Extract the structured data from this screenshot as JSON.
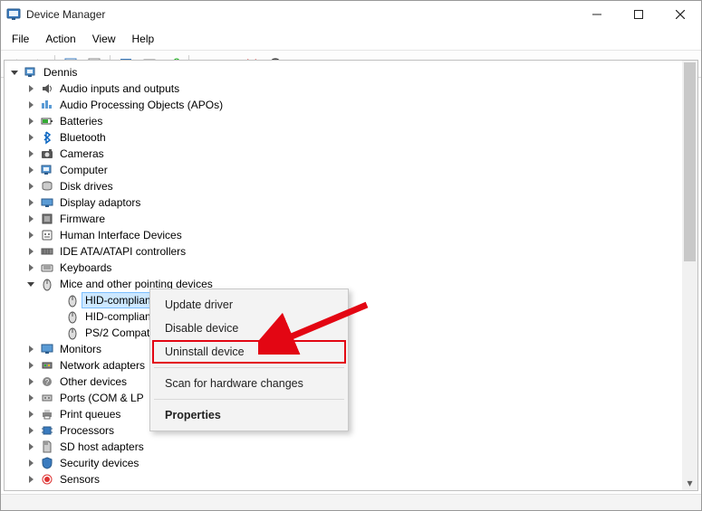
{
  "titlebar": {
    "title": "Device Manager"
  },
  "menubar": {
    "items": [
      "File",
      "Action",
      "View",
      "Help"
    ]
  },
  "tree": {
    "root": "Dennis",
    "categories": [
      {
        "label": "Audio inputs and outputs",
        "icon": "speaker"
      },
      {
        "label": "Audio Processing Objects (APOs)",
        "icon": "apo"
      },
      {
        "label": "Batteries",
        "icon": "battery"
      },
      {
        "label": "Bluetooth",
        "icon": "bluetooth"
      },
      {
        "label": "Cameras",
        "icon": "camera"
      },
      {
        "label": "Computer",
        "icon": "computer"
      },
      {
        "label": "Disk drives",
        "icon": "disk"
      },
      {
        "label": "Display adaptors",
        "icon": "display-adapter"
      },
      {
        "label": "Firmware",
        "icon": "firmware"
      },
      {
        "label": "Human Interface Devices",
        "icon": "hid"
      },
      {
        "label": "IDE ATA/ATAPI controllers",
        "icon": "ide"
      },
      {
        "label": "Keyboards",
        "icon": "keyboard"
      },
      {
        "label": "Mice and other pointing devices",
        "icon": "mouse",
        "expanded": true,
        "children": [
          {
            "label": "HID-complian",
            "selected": true
          },
          {
            "label": "HID-complian"
          },
          {
            "label": "PS/2 Compat"
          }
        ]
      },
      {
        "label": "Monitors",
        "icon": "monitor"
      },
      {
        "label": "Network adapters",
        "icon": "network"
      },
      {
        "label": "Other devices",
        "icon": "other"
      },
      {
        "label": "Ports (COM & LP",
        "icon": "port"
      },
      {
        "label": "Print queues",
        "icon": "printer"
      },
      {
        "label": "Processors",
        "icon": "cpu"
      },
      {
        "label": "SD host adapters",
        "icon": "sd"
      },
      {
        "label": "Security devices",
        "icon": "security"
      },
      {
        "label": "Sensors",
        "icon": "sensor"
      }
    ]
  },
  "context_menu": {
    "items": [
      {
        "label": "Update driver"
      },
      {
        "label": "Disable device"
      },
      {
        "label": "Uninstall device",
        "highlight": true
      },
      {
        "sep": true
      },
      {
        "label": "Scan for hardware changes"
      },
      {
        "sep": true
      },
      {
        "label": "Properties",
        "bold": true
      }
    ]
  }
}
